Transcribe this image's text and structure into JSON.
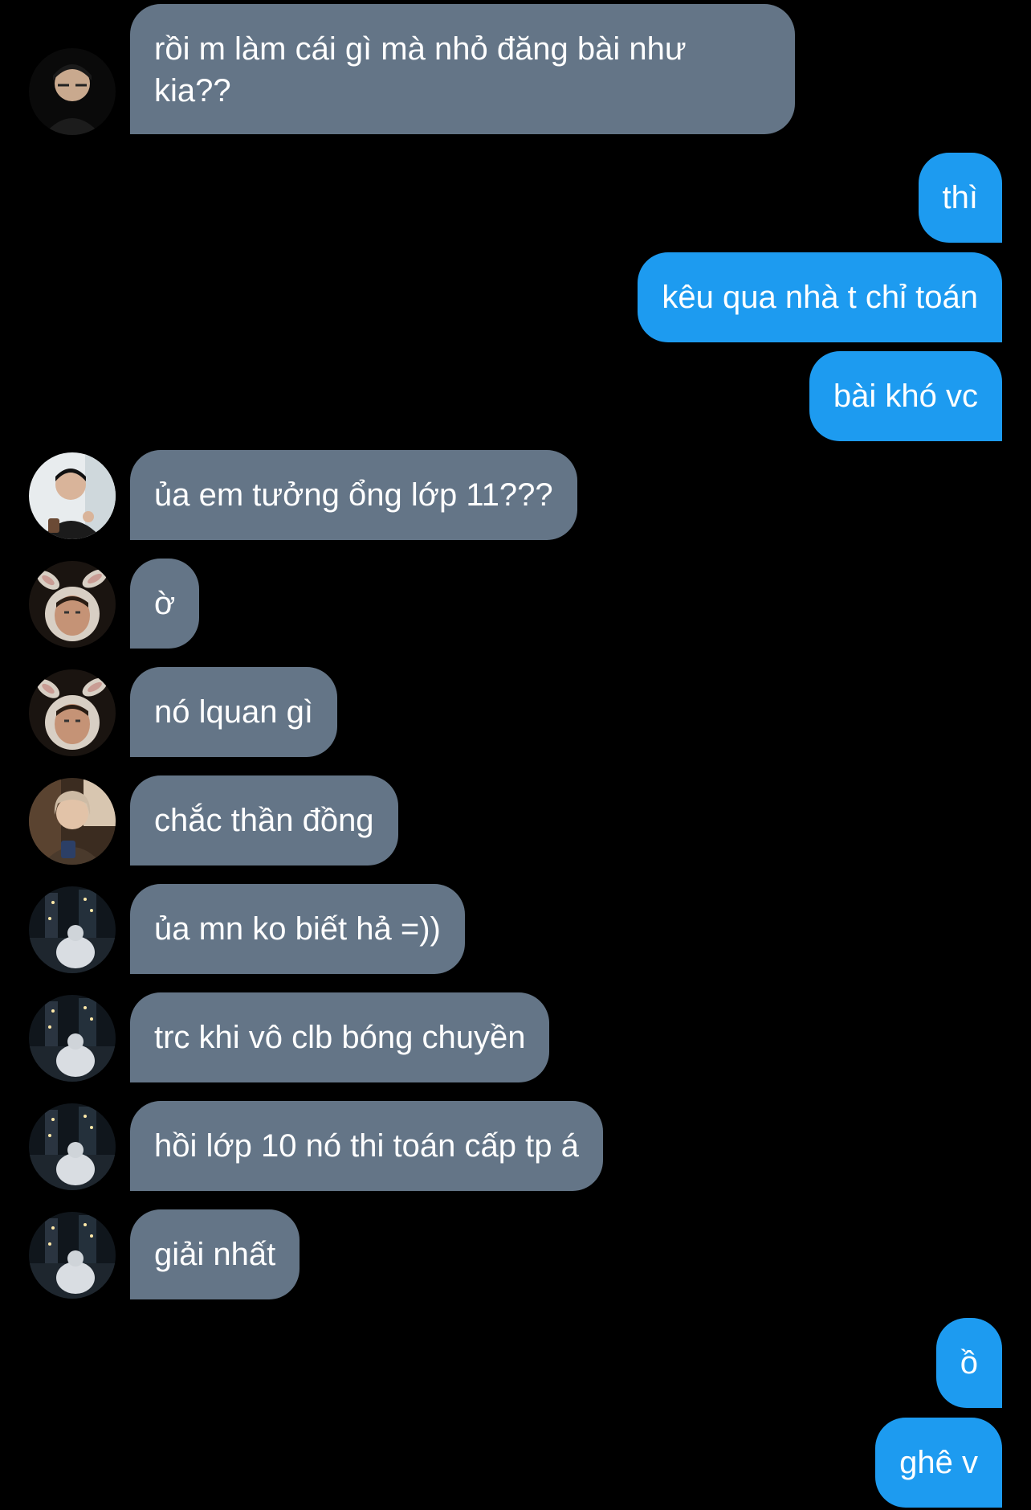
{
  "messages": [
    {
      "side": "in",
      "avatar": "person-glasses-avatar",
      "text": "rồi m làm cái gì mà nhỏ đăng bài như kia??"
    },
    {
      "side": "out",
      "text": "thì"
    },
    {
      "side": "out",
      "text": "kêu qua nhà t chỉ toán"
    },
    {
      "side": "out",
      "text": "bài khó vc"
    },
    {
      "side": "in",
      "avatar": "person-thumbs-up-avatar",
      "text": "ủa em tưởng ổng lớp 11???"
    },
    {
      "side": "in",
      "avatar": "bunny-ears-avatar",
      "text": "ờ"
    },
    {
      "side": "in",
      "avatar": "bunny-ears-avatar",
      "text": "nó lquan gì"
    },
    {
      "side": "in",
      "avatar": "person-light-hair-avatar",
      "text": "chắc thần đồng"
    },
    {
      "side": "in",
      "avatar": "night-street-avatar",
      "text": "ủa mn ko biết hả =))"
    },
    {
      "side": "in",
      "avatar": "night-street-avatar",
      "text": "trc khi vô clb bóng chuyền"
    },
    {
      "side": "in",
      "avatar": "night-street-avatar",
      "text": "hồi lớp 10 nó thi toán cấp tp á"
    },
    {
      "side": "in",
      "avatar": "night-street-avatar",
      "text": "giải nhất"
    },
    {
      "side": "out",
      "text": "ồ"
    },
    {
      "side": "out",
      "text": "ghê v"
    }
  ],
  "colors": {
    "background": "#000000",
    "incoming_bubble": "#647587",
    "outgoing_bubble": "#1d9bf0",
    "text": "#ffffff"
  }
}
